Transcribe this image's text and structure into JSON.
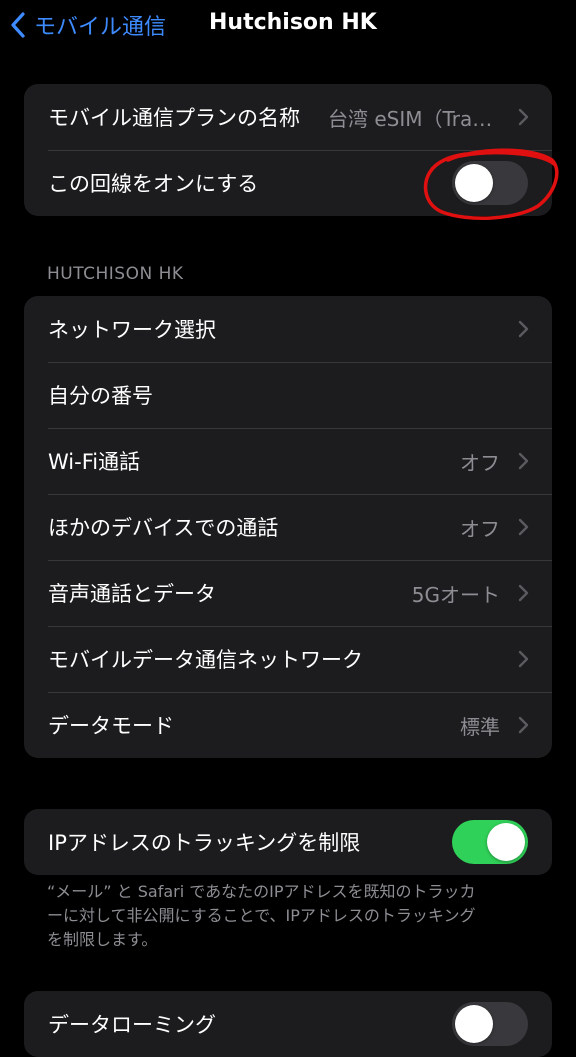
{
  "navbar": {
    "back_label": "モバイル通信",
    "title": "Hutchison HK"
  },
  "group1": {
    "rows": [
      {
        "label": "モバイル通信プランの名称",
        "value": "台湾 eSIM（Travel...",
        "chevron": true
      },
      {
        "label": "この回線をオンにする",
        "toggle": "off"
      }
    ]
  },
  "section_header": "HUTCHISON HK",
  "group2": {
    "rows": [
      {
        "label": "ネットワーク選択",
        "chevron": true
      },
      {
        "label": "自分の番号"
      },
      {
        "label": "Wi-Fi通話",
        "value": "オフ",
        "chevron": true
      },
      {
        "label": "ほかのデバイスでの通話",
        "value": "オフ",
        "chevron": true
      },
      {
        "label": "音声通話とデータ",
        "value": "5Gオート",
        "chevron": true
      },
      {
        "label": "モバイルデータ通信ネットワーク",
        "chevron": true
      },
      {
        "label": "データモード",
        "value": "標準",
        "chevron": true
      }
    ]
  },
  "group3": {
    "rows": [
      {
        "label": "IPアドレスのトラッキングを制限",
        "toggle": "on"
      }
    ]
  },
  "footnote": "“メール” と Safari であなたのIPアドレスを既知のトラッカーに対して非公開にすることで、IPアドレスのトラッキングを制限します。",
  "group4": {
    "rows": [
      {
        "label": "データローミング",
        "toggle": "off"
      }
    ]
  },
  "colors": {
    "accent": "#3d8bff",
    "toggle_on": "#30d158",
    "annotation": "#e01010"
  },
  "icons": [
    "chevron-left-icon",
    "chevron-right-icon"
  ]
}
